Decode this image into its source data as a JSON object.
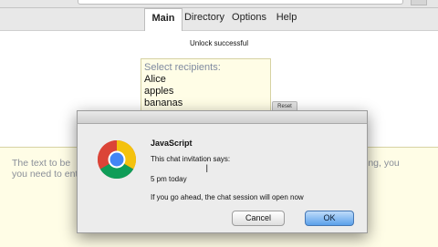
{
  "nav": {
    "items": [
      {
        "label": "Main",
        "active": true
      },
      {
        "label": "Directory",
        "active": false
      },
      {
        "label": "Options",
        "active": false
      },
      {
        "label": "Help",
        "active": false
      }
    ]
  },
  "status_text": "Unlock successful",
  "recipients": {
    "label": "Select recipients:",
    "options": [
      "Alice",
      "apples",
      "bananas"
    ]
  },
  "reset_label": "Reset",
  "message_area": {
    "left_text_line1": "The text to be",
    "left_text_line2": "you need to enter t",
    "right_text_line1": "ing, you"
  },
  "dialog": {
    "title": "JavaScript",
    "line1": "This chat invitation says:",
    "line2": "5 pm today",
    "line3": "If you go ahead, the chat session will open now",
    "cancel_label": "Cancel",
    "ok_label": "OK",
    "icon": "chrome-icon"
  },
  "colors": {
    "message_bg": "#fffde6",
    "ok_button": "#5aa0ea"
  }
}
